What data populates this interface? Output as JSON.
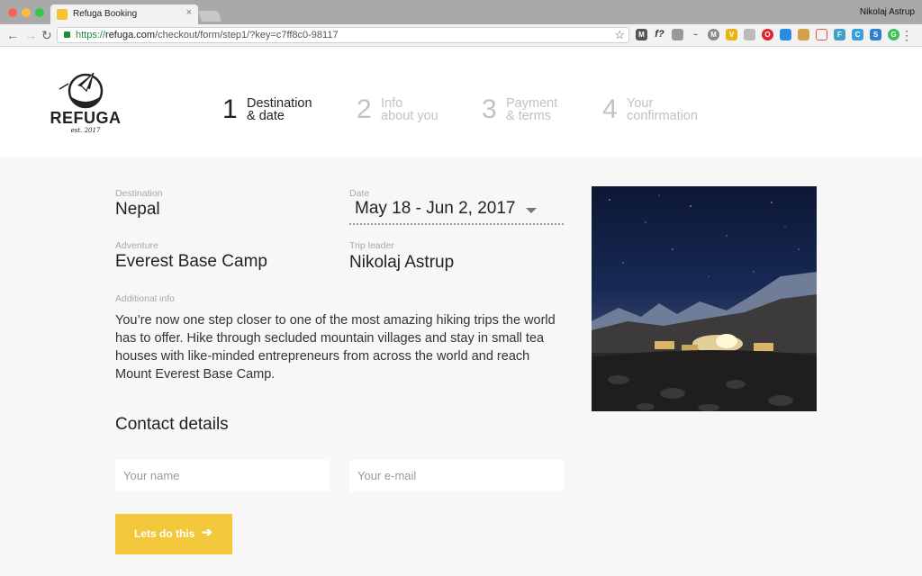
{
  "browser": {
    "tab_title": "Refuga Booking",
    "profile_name": "Nikolaj Astrup",
    "url_scheme": "https://",
    "url_host": "refuga.com",
    "url_path": "/checkout/form/step1/?key=c7ff8c0-98117"
  },
  "brand": {
    "name": "REFUGA",
    "tagline": "est. 2017"
  },
  "steps": [
    {
      "number": "1",
      "line1": "Destination",
      "line2": "& date",
      "state": "active"
    },
    {
      "number": "2",
      "line1": "Info",
      "line2": "about you",
      "state": "inactive"
    },
    {
      "number": "3",
      "line1": "Payment",
      "line2": "& terms",
      "state": "inactive"
    },
    {
      "number": "4",
      "line1": "Your",
      "line2": "confirmation",
      "state": "inactive"
    }
  ],
  "trip": {
    "destination_label": "Destination",
    "destination": "Nepal",
    "date_label": "Date",
    "date": "May 18 - Jun 2, 2017",
    "adventure_label": "Adventure",
    "adventure": "Everest Base Camp",
    "leader_label": "Trip leader",
    "leader": "Nikolaj Astrup",
    "info_label": "Additional info",
    "info": "You’re now one step closer to one of the most amazing hiking trips the world has to offer. Hike through secluded mountain villages and stay in small tea houses with like-minded entrepreneurs from across the world and reach Mount Everest Base Camp."
  },
  "contact": {
    "title": "Contact details",
    "name_placeholder": "Your name",
    "email_placeholder": "Your e-mail",
    "submit_label": "Lets do this",
    "submit_icon": "arrow-right-icon"
  },
  "colors": {
    "accent": "#f2c83a",
    "text": "#222222",
    "muted": "#c2c2c2"
  }
}
